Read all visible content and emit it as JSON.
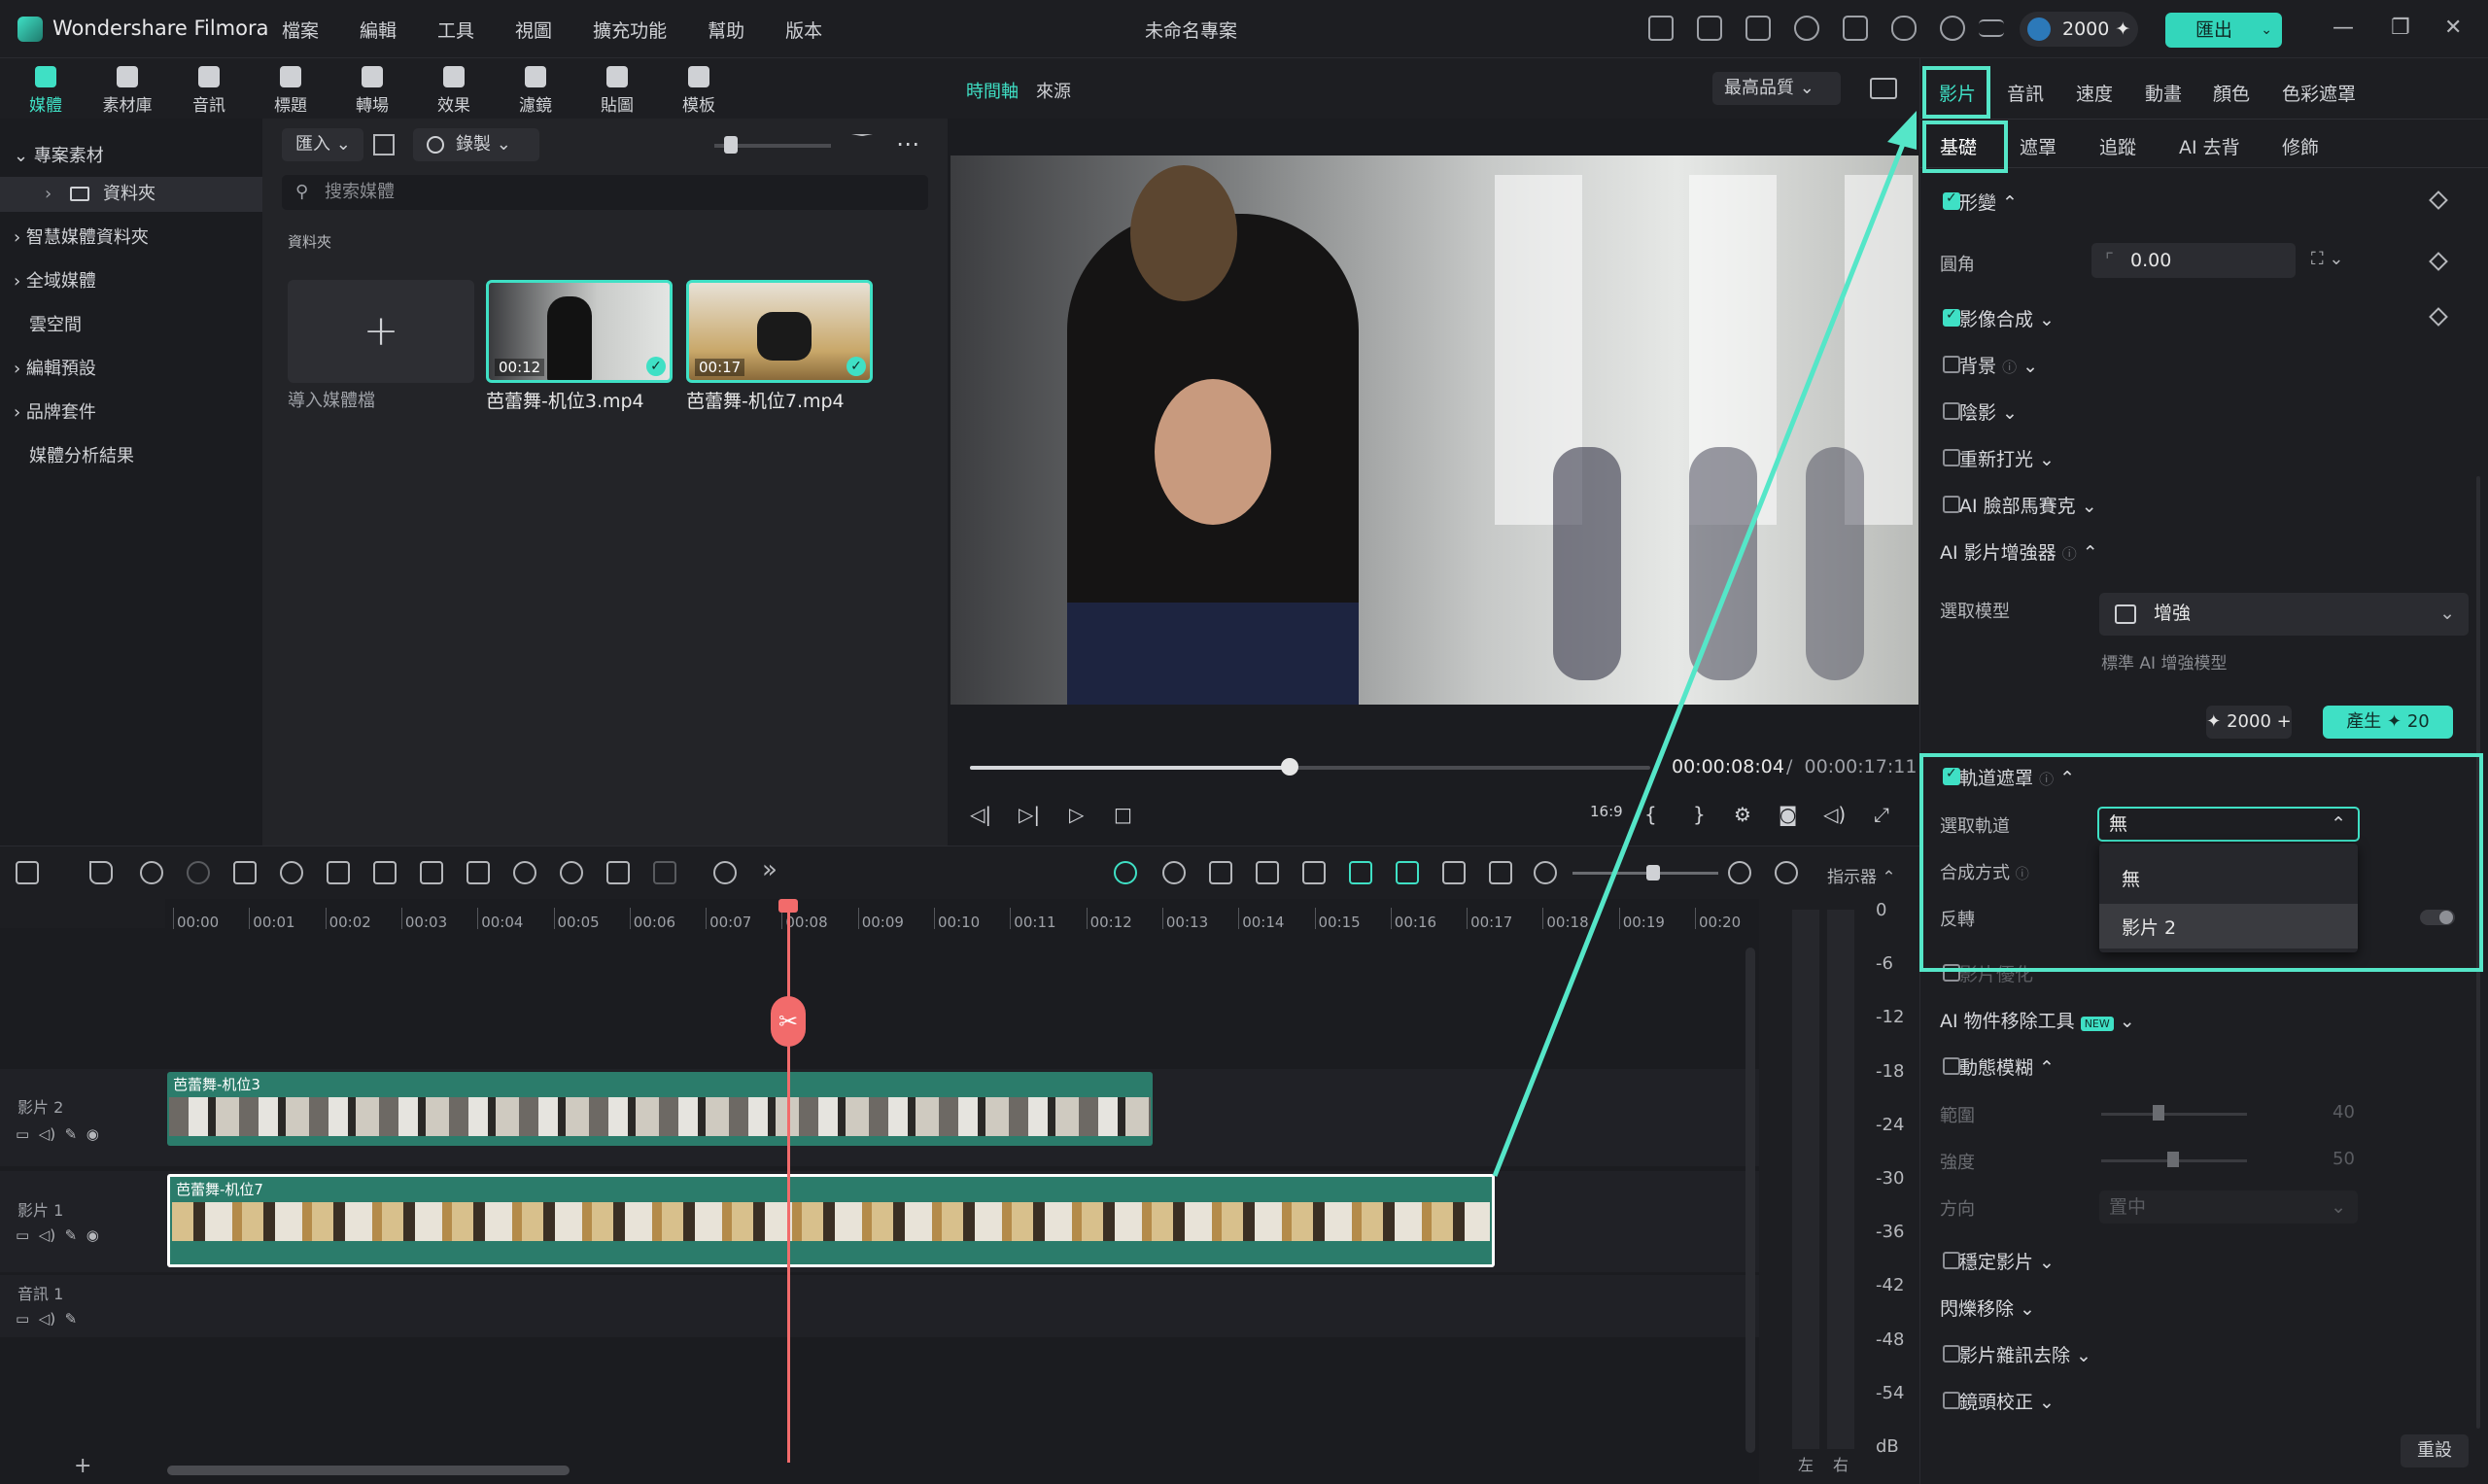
{
  "app": {
    "name": "Wondershare Filmora",
    "project_title": "未命名專案"
  },
  "menu": [
    "檔案",
    "編輯",
    "工具",
    "視圖",
    "擴充功能",
    "幫助",
    "版本"
  ],
  "credits": "2000",
  "export_label": "匯出",
  "media_tabs": [
    "媒體",
    "素材庫",
    "音訊",
    "標題",
    "轉場",
    "效果",
    "濾鏡",
    "貼圖",
    "模板"
  ],
  "sidebar": {
    "items": [
      "專案素材",
      "資料夾",
      "智慧媒體資料夾",
      "全域媒體",
      "雲空間",
      "編輯預設",
      "品牌套件",
      "媒體分析結果"
    ]
  },
  "media": {
    "import_label": "匯入",
    "record_label": "錄製",
    "search_placeholder": "搜索媒體",
    "folder_heading": "資料夾",
    "import_tile_label": "導入媒體檔",
    "clips": [
      {
        "duration": "00:12",
        "name": "芭蕾舞-机位3.mp4"
      },
      {
        "duration": "00:17",
        "name": "芭蕾舞-机位7.mp4"
      }
    ]
  },
  "preview": {
    "tab_timeline": "時間軸",
    "tab_source": "來源",
    "quality": "最高品質",
    "progress": 0.47,
    "time_current": "00:00:08:04",
    "time_separator": "/",
    "time_total": "00:00:17:11",
    "ratio": "16:9"
  },
  "right_panel": {
    "tabs": [
      "影片",
      "音訊",
      "速度",
      "動畫",
      "顏色",
      "色彩遮罩"
    ],
    "subtabs": [
      "基礎",
      "遮罩",
      "追蹤",
      "AI 去背",
      "修飾"
    ],
    "props": {
      "transform": "形變",
      "corner": "圓角",
      "corner_value": "0.00",
      "composite": "影像合成",
      "background": "背景",
      "shadow": "陰影",
      "relight": "重新打光",
      "face_mosaic": "AI 臉部馬賽克",
      "enhancer": "AI 影片增強器",
      "select_model": "選取模型",
      "model_value": "增強",
      "model_desc": "標準 AI 增強模型",
      "cost": "2000",
      "generate_label": "產生",
      "generate_cost": "20",
      "track_matte": "軌道遮罩",
      "select_track": "選取軌道",
      "select_track_value": "無",
      "blend_mode": "合成方式",
      "invert": "反轉",
      "video_matte_hidden": "影片優化",
      "object_removal": "AI 物件移除工具",
      "new_badge": "NEW",
      "motion_blur": "動態模糊",
      "range": "範圍",
      "range_value": "40",
      "strength": "強度",
      "strength_value": "50",
      "direction": "方向",
      "direction_value": "置中",
      "stabilize": "穩定影片",
      "flicker": "閃爍移除",
      "denoise": "影片雜訊去除",
      "lens": "鏡頭校正",
      "reset": "重設"
    },
    "dropdown_options": [
      "無",
      "影片 2"
    ]
  },
  "timeline": {
    "indicator_label": "指示器",
    "ticks": [
      "00:00",
      "00:01",
      "00:02",
      "00:03",
      "00:04",
      "00:05",
      "00:06",
      "00:07",
      "00:08",
      "00:09",
      "00:10",
      "00:11",
      "00:12",
      "00:13",
      "00:14",
      "00:15",
      "00:16",
      "00:17",
      "00:18",
      "00:19",
      "00:20"
    ],
    "tracks": [
      "影片 2",
      "影片 1",
      "音訊 1"
    ],
    "clip_labels": [
      "芭蕾舞-机位3",
      "芭蕾舞-机位7"
    ],
    "db_scale": [
      "0",
      "-6",
      "-12",
      "-18",
      "-24",
      "-30",
      "-36",
      "-42",
      "-48",
      "-54",
      "dB"
    ],
    "meter_left": "左",
    "meter_right": "右",
    "add": "+"
  },
  "colors": {
    "accent": "#3fe0c5",
    "highlight": "#55e6c8",
    "playhead": "#f26b6b",
    "clip": "#2b7c6b"
  }
}
